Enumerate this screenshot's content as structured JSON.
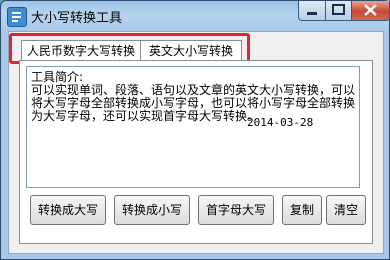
{
  "window": {
    "title": "大小写转换工具"
  },
  "tabs": [
    {
      "label": "人民币数字大写转换"
    },
    {
      "label": "英文大小写转换"
    }
  ],
  "editor": {
    "text": "工具简介:\n可以实现单词、段落、语句以及文章的英文大小写转换，可以将大写字母全部转换成小写字母，也可以将小写字母全部转换为大写字母，还可以实现首字母大写转换。",
    "date": "2014-03-28"
  },
  "buttons": {
    "to_upper": "转换成大写",
    "to_lower": "转换成小写",
    "capitalize": "首字母大写",
    "copy": "复制",
    "clear": "清空"
  },
  "colors": {
    "highlight": "#e0282e",
    "title_bar": "#a9c9e8",
    "close_button": "#c84a32"
  }
}
